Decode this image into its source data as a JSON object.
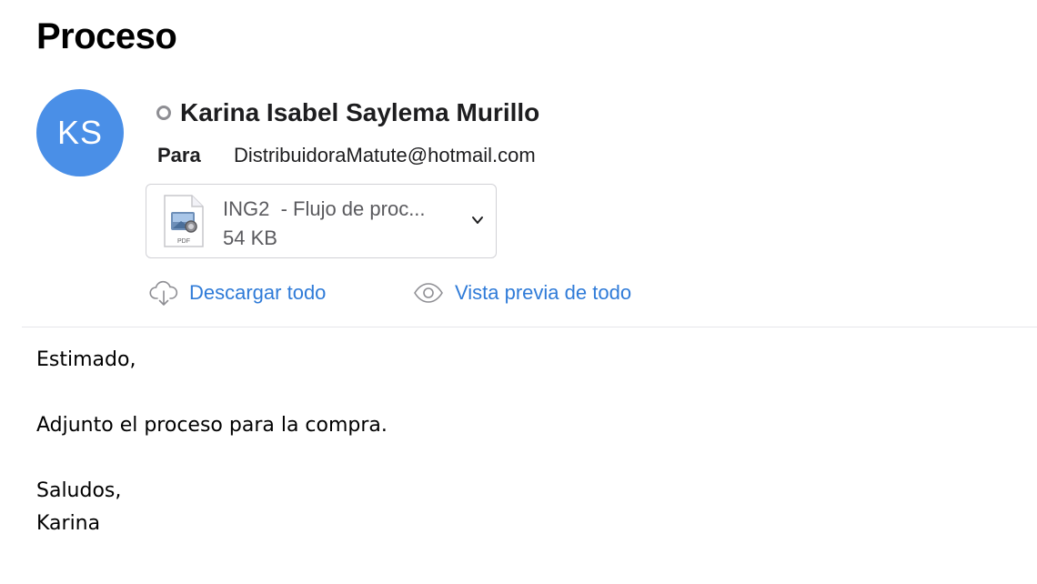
{
  "message": {
    "subject": "Proceso",
    "sender": {
      "initials": "KS",
      "name": "Karina Isabel Saylema Murillo"
    },
    "to_label": "Para",
    "to_address": "DistribuidoraMatute@hotmail.com"
  },
  "attachment": {
    "name": "ING2  - Flujo de proc...",
    "size": "54 KB",
    "icon_label": "PDF"
  },
  "actions": {
    "download_all": "Descargar todo",
    "preview_all": "Vista previa de todo"
  },
  "body": {
    "greeting": "Estimado,",
    "line1": "Adjunto el proceso para la compra.",
    "closing": "Saludos,",
    "signature": "Karina"
  },
  "colors": {
    "avatar": "#4a8fe7",
    "link": "#2f7bd8"
  }
}
